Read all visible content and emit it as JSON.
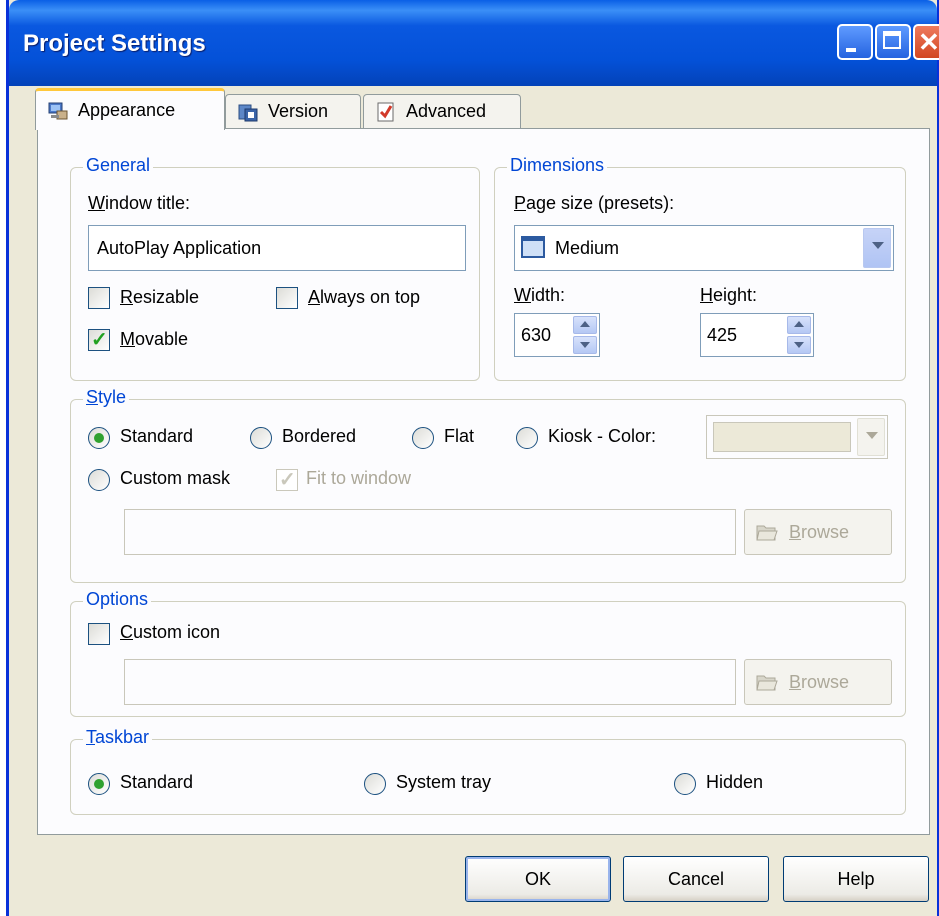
{
  "window": {
    "title": "Project Settings"
  },
  "tabs": [
    {
      "label": "Appearance",
      "icon": "monitor-icon",
      "active": true
    },
    {
      "label": "Version",
      "icon": "version-icon",
      "active": false
    },
    {
      "label": "Advanced",
      "icon": "checklist-icon",
      "active": false
    }
  ],
  "general": {
    "legend": "General",
    "window_title_label": "Window title:",
    "window_title_value": "AutoPlay Application",
    "resizable_label": "Resizable",
    "resizable_checked": false,
    "always_on_top_label": "Always on top",
    "always_on_top_checked": false,
    "movable_label": "Movable",
    "movable_checked": true
  },
  "dimensions": {
    "legend": "Dimensions",
    "page_size_label": "Page size (presets):",
    "page_size_value": "Medium",
    "width_label": "Width:",
    "width_value": "630",
    "height_label": "Height:",
    "height_value": "425"
  },
  "style": {
    "legend": "Style",
    "standard_label": "Standard",
    "bordered_label": "Bordered",
    "flat_label": "Flat",
    "kiosk_label": "Kiosk - Color:",
    "custom_mask_label": "Custom mask",
    "fit_to_window_label": "Fit to window",
    "fit_to_window_checked": true,
    "selected": "Standard",
    "kiosk_color": "#ece9d8",
    "mask_path": "",
    "browse_label": "Browse"
  },
  "options": {
    "legend": "Options",
    "custom_icon_label": "Custom icon",
    "custom_icon_checked": false,
    "icon_path": "",
    "browse_label": "Browse"
  },
  "taskbar": {
    "legend": "Taskbar",
    "standard_label": "Standard",
    "system_tray_label": "System tray",
    "hidden_label": "Hidden",
    "selected": "Standard"
  },
  "footer": {
    "ok_label": "OK",
    "cancel_label": "Cancel",
    "help_label": "Help"
  },
  "colors": {
    "titlebar": "#0451d8",
    "dialog_bg": "#ece9d8",
    "panel_bg": "#fcfcfe",
    "group_legend": "#0046d5",
    "tab_highlight": "#ffc83c"
  }
}
